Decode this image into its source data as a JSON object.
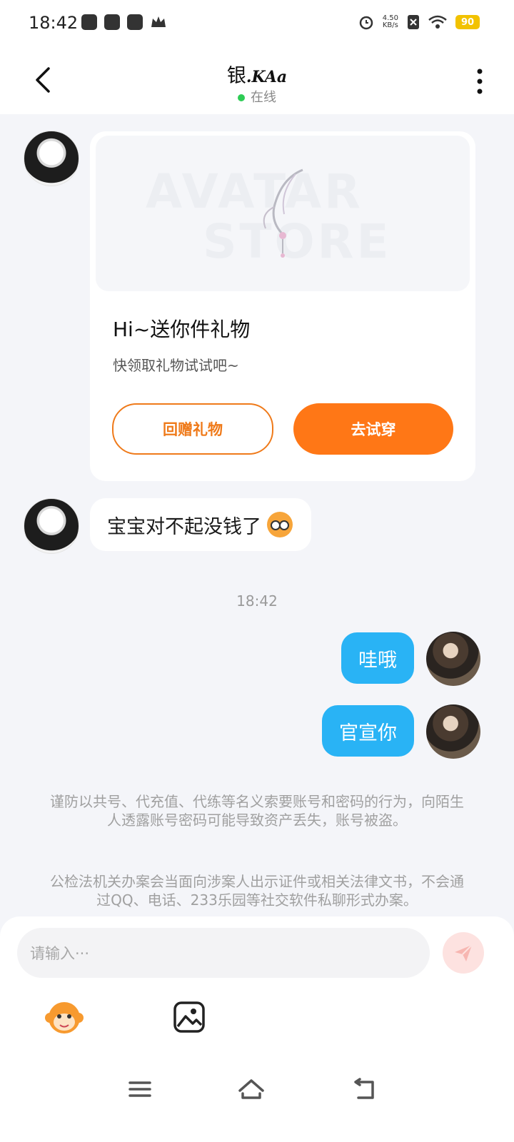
{
  "status_bar": {
    "time": "18:42",
    "network_speed_value": "4.50",
    "network_speed_unit": "KB/s",
    "battery": "90"
  },
  "header": {
    "title_cn": "银",
    "title_script": ".KAa",
    "status": "在线"
  },
  "gift_card": {
    "banner_text_line1": "AVATAR",
    "banner_text_line2": "STORE",
    "title": "Hi~送你件礼物",
    "subtitle": "快领取礼物试试吧~",
    "return_gift_label": "回赠礼物",
    "try_on_label": "去试穿"
  },
  "messages": {
    "other_1": "宝宝对不起没钱了",
    "timestamp": "18:42",
    "self_1": "哇哦",
    "self_2": "官宣你"
  },
  "notices": {
    "notice_1": "谨防以共号、代充值、代练等名义索要账号和密码的行为，向陌生人透露账号密码可能导致资产丢失，账号被盗。",
    "notice_2": "公检法机关办案会当面向涉案人出示证件或相关法律文书，不会通过QQ、电话、233乐园等社交软件私聊形式办案。"
  },
  "composer": {
    "placeholder": "请输入···"
  },
  "colors": {
    "accent_orange": "#ff7716",
    "bubble_blue": "#29b3f5",
    "online_green": "#2ecc55"
  },
  "icons": [
    "back-icon",
    "more-icon",
    "send-icon",
    "emoji-icon",
    "image-icon",
    "menu-icon",
    "home-icon",
    "back-nav-icon"
  ]
}
